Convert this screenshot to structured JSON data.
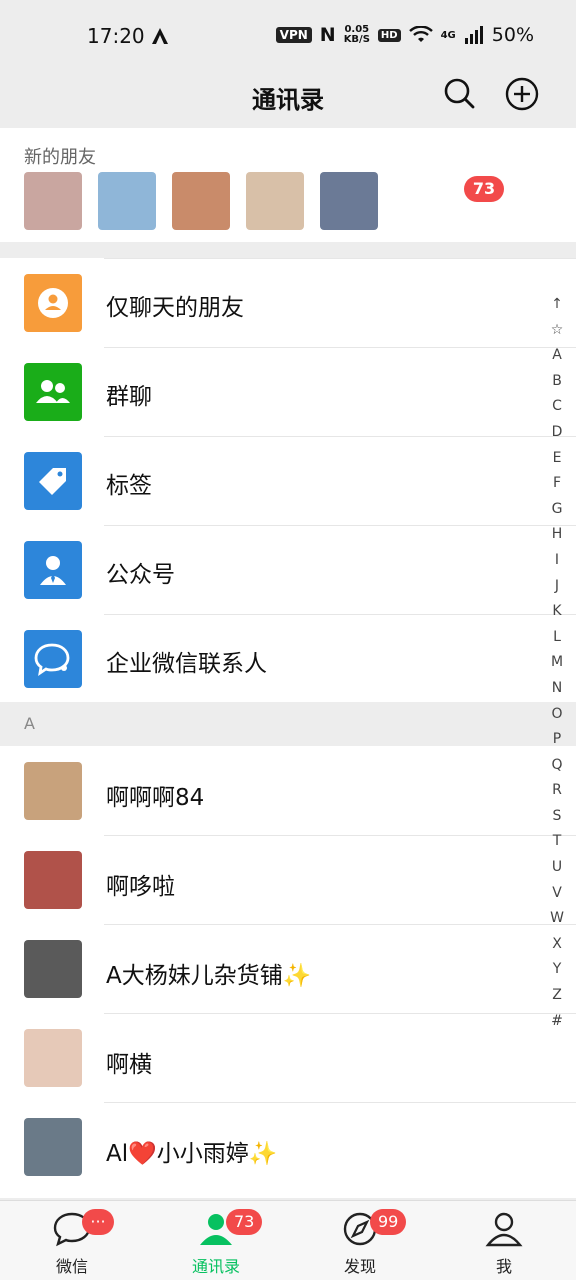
{
  "status_bar": {
    "time": "17:20",
    "vpn": "VPN",
    "nfc": "N",
    "speed_value": "0.05",
    "speed_unit": "KB/S",
    "hd": "HD",
    "network": "4G",
    "battery": "50%"
  },
  "header": {
    "title": "通讯录"
  },
  "new_friends": {
    "label": "新的朋友",
    "badge": "73",
    "avatar_colors": [
      "#c9a6a0",
      "#8fb6d8",
      "#c98b6a",
      "#d8c0a8",
      "#6b7a96"
    ]
  },
  "menu": [
    {
      "label": "仅聊天的朋友",
      "icon": "chat-only-friends-icon",
      "color": "#f79c3b"
    },
    {
      "label": "群聊",
      "icon": "group-chat-icon",
      "color": "#1aad19"
    },
    {
      "label": "标签",
      "icon": "tag-icon",
      "color": "#2d86da"
    },
    {
      "label": "公众号",
      "icon": "official-account-icon",
      "color": "#2d86da"
    },
    {
      "label": "企业微信联系人",
      "icon": "work-contacts-icon",
      "color": "#2d86da"
    }
  ],
  "section": {
    "letter": "A"
  },
  "contacts": [
    {
      "name": "啊啊啊84",
      "color": "#c8a27c"
    },
    {
      "name": "啊哆啦",
      "color": "#b0524a"
    },
    {
      "name": "A大杨妹儿杂货铺✨",
      "color": "#5a5a5a"
    },
    {
      "name": "啊横",
      "color": "#e6c9b8"
    },
    {
      "name": "Al❤️小小雨婷✨",
      "color": "#6a7a88"
    }
  ],
  "alpha_index": [
    "↑",
    "☆",
    "A",
    "B",
    "C",
    "D",
    "E",
    "F",
    "G",
    "H",
    "I",
    "J",
    "K",
    "L",
    "M",
    "N",
    "O",
    "P",
    "Q",
    "R",
    "S",
    "T",
    "U",
    "V",
    "W",
    "X",
    "Y",
    "Z",
    "#"
  ],
  "tabs": [
    {
      "label": "微信",
      "badge": "···",
      "icon": "chat-bubble-icon"
    },
    {
      "label": "通讯录",
      "badge": "73",
      "icon": "contacts-person-icon"
    },
    {
      "label": "发现",
      "badge": "99",
      "icon": "compass-icon"
    },
    {
      "label": "我",
      "badge": "",
      "icon": "me-person-icon"
    }
  ],
  "colors": {
    "accent": "#07c160",
    "badge": "#f24a4a"
  }
}
